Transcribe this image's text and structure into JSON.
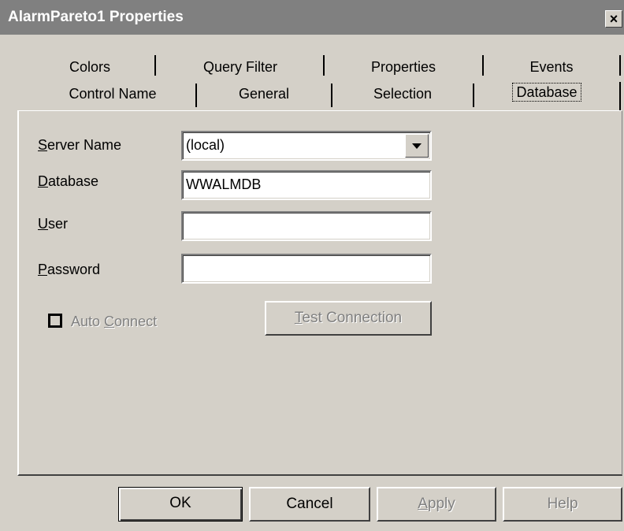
{
  "window": {
    "title": "AlarmPareto1 Properties",
    "close_glyph": "×"
  },
  "tabs": {
    "row_back": [
      {
        "label": "Colors"
      },
      {
        "label": "Query Filter"
      },
      {
        "label": "Properties"
      },
      {
        "label": "Events"
      }
    ],
    "row_front": [
      {
        "label": "Control Name"
      },
      {
        "label": "General"
      },
      {
        "label": "Selection"
      },
      {
        "label": "Database",
        "active": true
      }
    ]
  },
  "form": {
    "server_name": {
      "label_mnemonic": "S",
      "label_rest": "erver Name",
      "value": "(local)"
    },
    "database": {
      "label_mnemonic": "D",
      "label_rest": "atabase",
      "value": "WWALMDB"
    },
    "user": {
      "label_mnemonic": "U",
      "label_rest": "ser",
      "value": ""
    },
    "password": {
      "label_mnemonic": "P",
      "label_rest": "assword",
      "value": ""
    },
    "auto_connect": {
      "label_pre": "Auto ",
      "label_mnemonic": "C",
      "label_rest": "onnect",
      "checked": false,
      "enabled": false
    },
    "test_connection": {
      "label_mnemonic": "T",
      "label_rest": "est Connection",
      "enabled": false
    }
  },
  "buttons": {
    "ok": "OK",
    "cancel": "Cancel",
    "apply_mnemonic": "A",
    "apply_rest": "pply",
    "help": "Help"
  }
}
